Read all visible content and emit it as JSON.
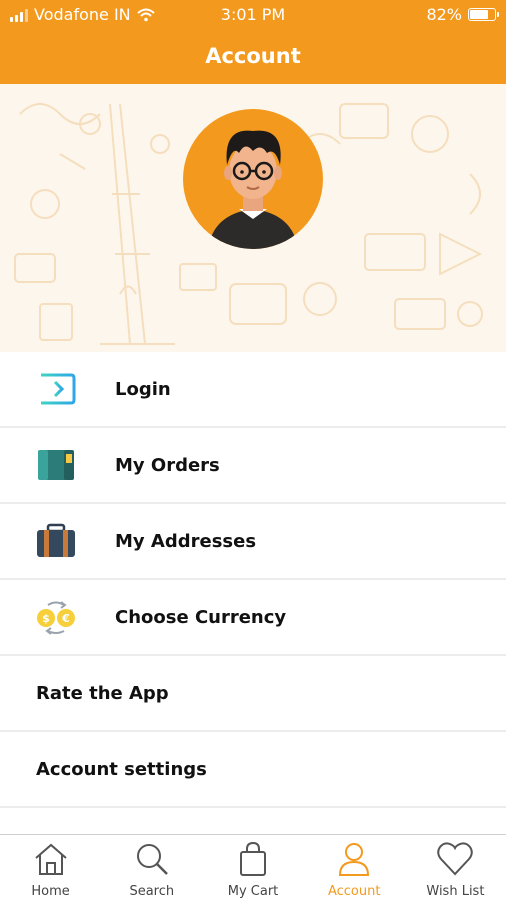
{
  "status_bar": {
    "carrier": "Vodafone IN",
    "time": "3:01 PM",
    "battery_percent": "82%",
    "battery_level": 0.82
  },
  "header": {
    "title": "Account"
  },
  "menu": [
    {
      "label": "Login",
      "icon": "login-icon"
    },
    {
      "label": "My Orders",
      "icon": "orders-book-icon"
    },
    {
      "label": "My Addresses",
      "icon": "address-briefcase-icon"
    },
    {
      "label": "Choose Currency",
      "icon": "currency-exchange-icon"
    },
    {
      "label": "Rate the App"
    },
    {
      "label": "Account settings"
    }
  ],
  "tabs": [
    {
      "label": "Home",
      "icon": "home-icon"
    },
    {
      "label": "Search",
      "icon": "search-icon"
    },
    {
      "label": "My Cart",
      "icon": "shopping-bag-icon"
    },
    {
      "label": "Account",
      "icon": "user-icon",
      "active": true
    },
    {
      "label": "Wish List",
      "icon": "heart-icon"
    }
  ],
  "colors": {
    "accent": "#f39a1e",
    "active_tab": "#f39a1e"
  }
}
